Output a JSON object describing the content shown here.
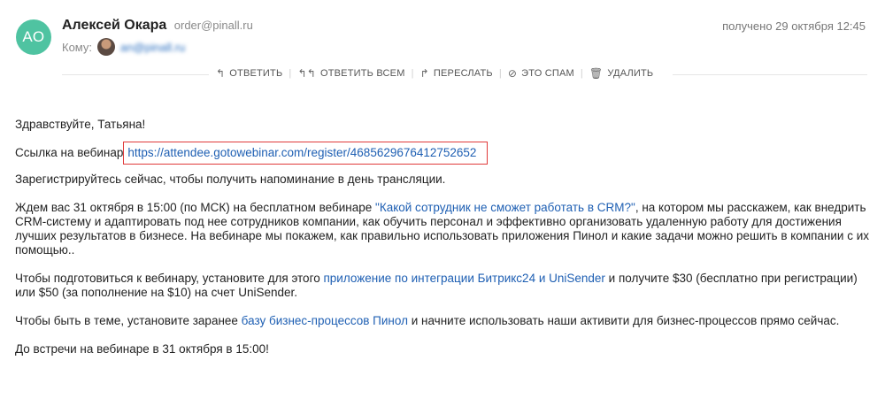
{
  "email": {
    "avatar_initials": "АО",
    "sender_name": "Алексей Окара",
    "sender_email": "order@pinall.ru",
    "to_label": "Кому:",
    "to_email": "an@pinall.ru",
    "received": "получено 29 октября 12:45"
  },
  "toolbar": {
    "reply": "ОТВЕТИТЬ",
    "reply_all": "ОТВЕТИТЬ ВСЕМ",
    "forward": "ПЕРЕСЛАТЬ",
    "spam": "ЭТО СПАМ",
    "delete": "УДАЛИТЬ"
  },
  "body": {
    "greeting": "Здравствуйте, Татьяна!",
    "link_label": "Ссылка на вебинар",
    "webinar_link": "https://attendee.gotowebinar.com/register/4685629676412752652",
    "register_line": "Зарегистрируйтесь сейчас, чтобы получить напоминание в день трансляции.",
    "para1_before": "Ждем вас 31 октября в 15:00 (по МСК) на бесплатном вебинаре ",
    "para1_link": "\"Какой сотрудник не сможет работать в CRM?\"",
    "para1_after": ", на котором мы расскажем,  как внедрить CRM-систему и адаптировать под нее сотрудников компании, как обучить персонал и эффективно организовать удаленную работу для достижения лучших результатов в бизнесе. На вебинаре мы покажем, как правильно использовать приложения Пинол и какие задачи можно решить в компании с их помощью..",
    "para2_before": "Чтобы подготовиться к вебинару, установите для этого ",
    "para2_link": "приложение по интеграции Битрикс24 и UniSender",
    "para2_after": " и получите  $30 (бесплатно при регистрации) или $50  (за пополнение на $10) на счет UniSender.",
    "para3_before": "Чтобы быть в теме, установите заранее ",
    "para3_link": "базу бизнес-процессов Пинол",
    "para3_after": " и начните использовать наши активити для бизнес-процессов прямо сейчас.",
    "closing": "До встречи на вебинаре в 31 октября в 15:00!"
  },
  "colors": {
    "avatar_bg": "#4fc3a1",
    "link": "#1e5fb3",
    "highlight_box": "#e03a3a"
  }
}
